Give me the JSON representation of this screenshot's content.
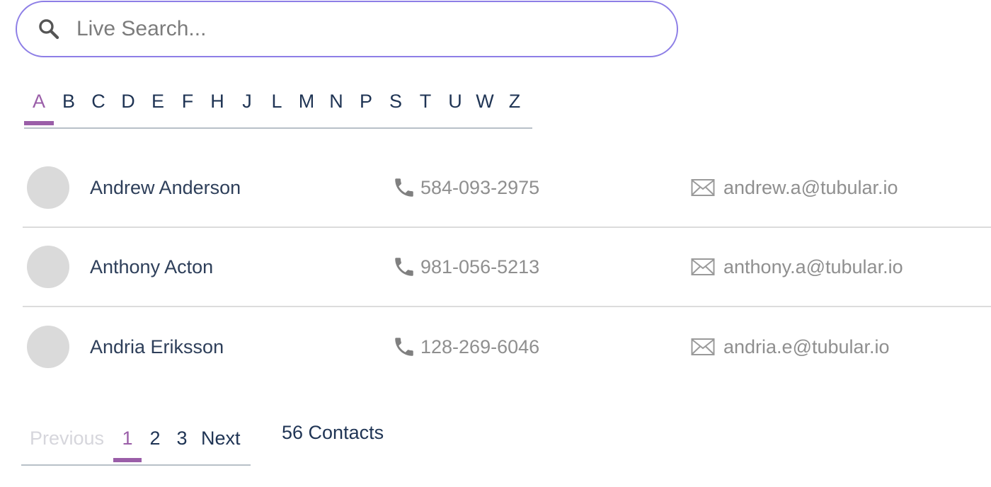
{
  "search": {
    "placeholder": "Live Search..."
  },
  "alphabet": {
    "letters": [
      "A",
      "B",
      "C",
      "D",
      "E",
      "F",
      "H",
      "J",
      "L",
      "M",
      "N",
      "P",
      "S",
      "T",
      "U",
      "W",
      "Z"
    ],
    "active": "A"
  },
  "contacts": [
    {
      "name": "Andrew Anderson",
      "phone": "584-093-2975",
      "email": "andrew.a@tubular.io"
    },
    {
      "name": "Anthony Acton",
      "phone": "981-056-5213",
      "email": "anthony.a@tubular.io"
    },
    {
      "name": "Andria Eriksson",
      "phone": "128-269-6046",
      "email": "andria.e@tubular.io"
    }
  ],
  "pagination": {
    "previous": "Previous",
    "pages": [
      "1",
      "2",
      "3"
    ],
    "current": "1",
    "next": "Next",
    "count_label": "56 Contacts"
  },
  "colors": {
    "accent": "#9a5ea8",
    "search_border": "#8d7ee6",
    "text_dark": "#1f3454",
    "text_muted": "#8f8f8f"
  },
  "icons": {
    "search": "search-icon",
    "phone": "phone-icon",
    "email": "envelope-icon"
  }
}
